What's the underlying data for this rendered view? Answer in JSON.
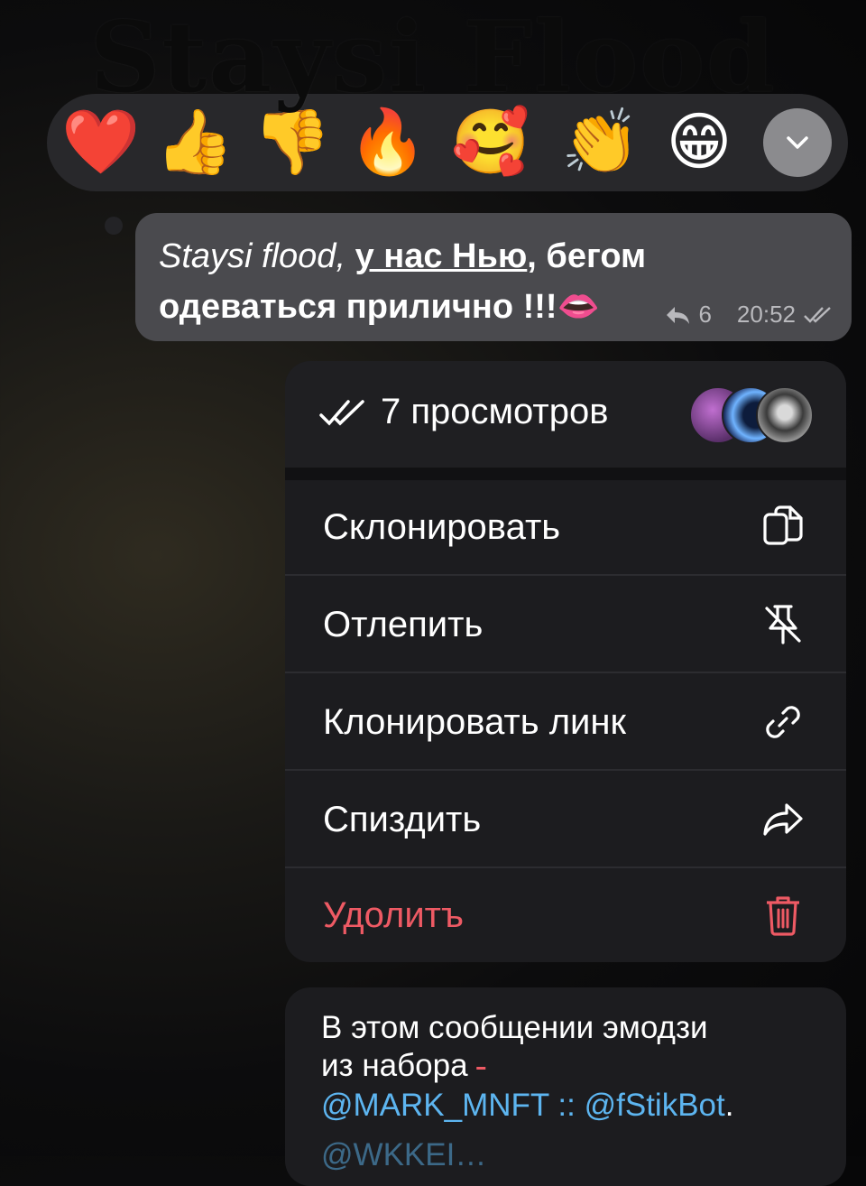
{
  "watermark": "Staysi Flood",
  "reactions": [
    {
      "name": "heart",
      "glyph": "❤️"
    },
    {
      "name": "thumbs-up",
      "glyph": "👍"
    },
    {
      "name": "thumbs-down",
      "glyph": "👎"
    },
    {
      "name": "fire",
      "glyph": "🔥"
    },
    {
      "name": "smiling-face-with-hearts",
      "glyph": "🥰"
    },
    {
      "name": "clapping-hands",
      "glyph": "👏"
    },
    {
      "name": "grinning-face",
      "glyph": "😁"
    }
  ],
  "message": {
    "part1": "Staysi flood, ",
    "link": "у нас Нью",
    "part2": ", бегом одеваться прилично !!!",
    "emoji": "👄",
    "replies": "6",
    "time": "20:52"
  },
  "menu": {
    "views": "7 просмотров",
    "items": [
      {
        "label": "Склонировать",
        "icon": "copy-icon"
      },
      {
        "label": "Отлепить",
        "icon": "unpin-icon"
      },
      {
        "label": "Клонировать линк",
        "icon": "link-icon"
      },
      {
        "label": "Спиздить",
        "icon": "forward-icon"
      },
      {
        "label": "Удолитъ",
        "icon": "trash-icon"
      }
    ]
  },
  "info": {
    "line1": "В этом сообщении эмодзи",
    "line2": "из набора",
    "mention1": "@MARK_MNFT",
    "separator": " :: ",
    "mention2": "@fStikBot",
    "end": ".",
    "cut_line": "@WKKEI…"
  },
  "colors": {
    "danger": "#ee5a64",
    "mention": "#5db5f0",
    "message_bg": "#4a4a4e",
    "menu_bg": "#1c1c1f"
  }
}
